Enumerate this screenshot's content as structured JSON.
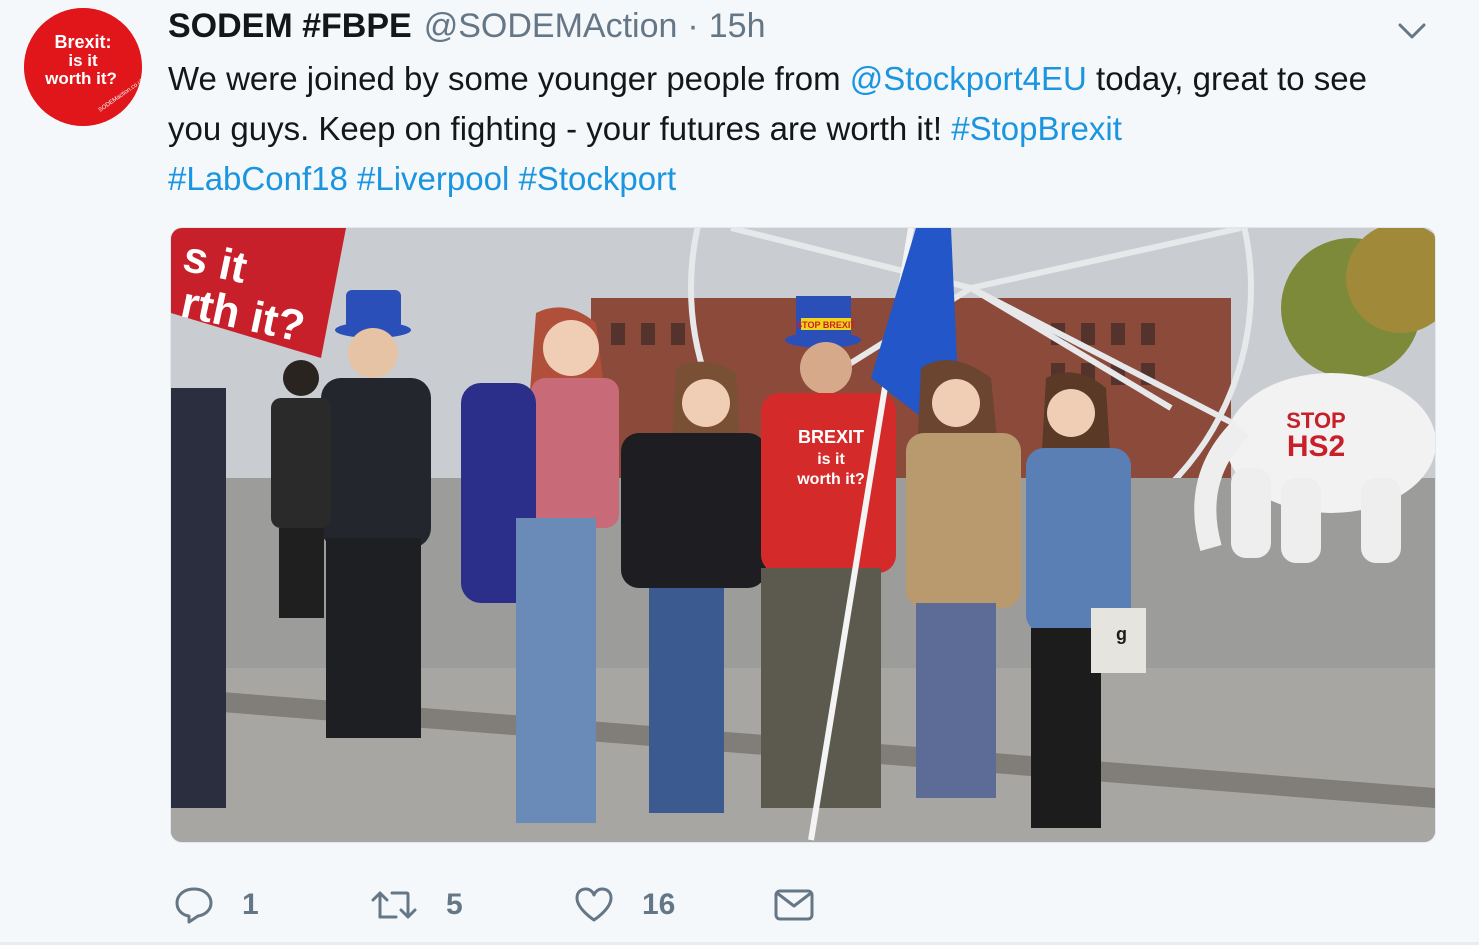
{
  "tweet": {
    "avatar": {
      "line1": "Brexit:",
      "line2": "is it",
      "line3": "worth it?",
      "ring_text": "SODEMaction.co.uk",
      "icon": "avatar-badge",
      "color": "#e0161b"
    },
    "display_name": "SODEM #FBPE",
    "handle": "@SODEMAction",
    "separator": "·",
    "time": "15h",
    "caret_icon": "chevron-down-icon",
    "text": {
      "part1": "We were joined by some younger people from ",
      "mention": "@Stockport4EU",
      "part2": " today, great to see you guys. Keep on fighting - your futures are worth it! ",
      "hashtags": [
        "#StopBrexit",
        "#LabConf18",
        "#Liverpool",
        "#Stockport"
      ]
    },
    "photo": {
      "banner_text": [
        "s it",
        "rth it?"
      ],
      "hat_text": "STOP BREXIT",
      "shirt_text": [
        "BREXIT",
        "is it",
        "worth it?"
      ],
      "elephant_text": [
        "STOP",
        "HS2"
      ],
      "bag_text": "g"
    },
    "actions": {
      "reply": {
        "icon": "reply-icon",
        "count": "1"
      },
      "retweet": {
        "icon": "retweet-icon",
        "count": "5"
      },
      "like": {
        "icon": "heart-icon",
        "count": "16"
      },
      "message": {
        "icon": "envelope-icon"
      }
    },
    "colors": {
      "link": "#1b95e0",
      "text": "#14171a",
      "muted": "#657786",
      "background": "#f5f8fa"
    }
  }
}
